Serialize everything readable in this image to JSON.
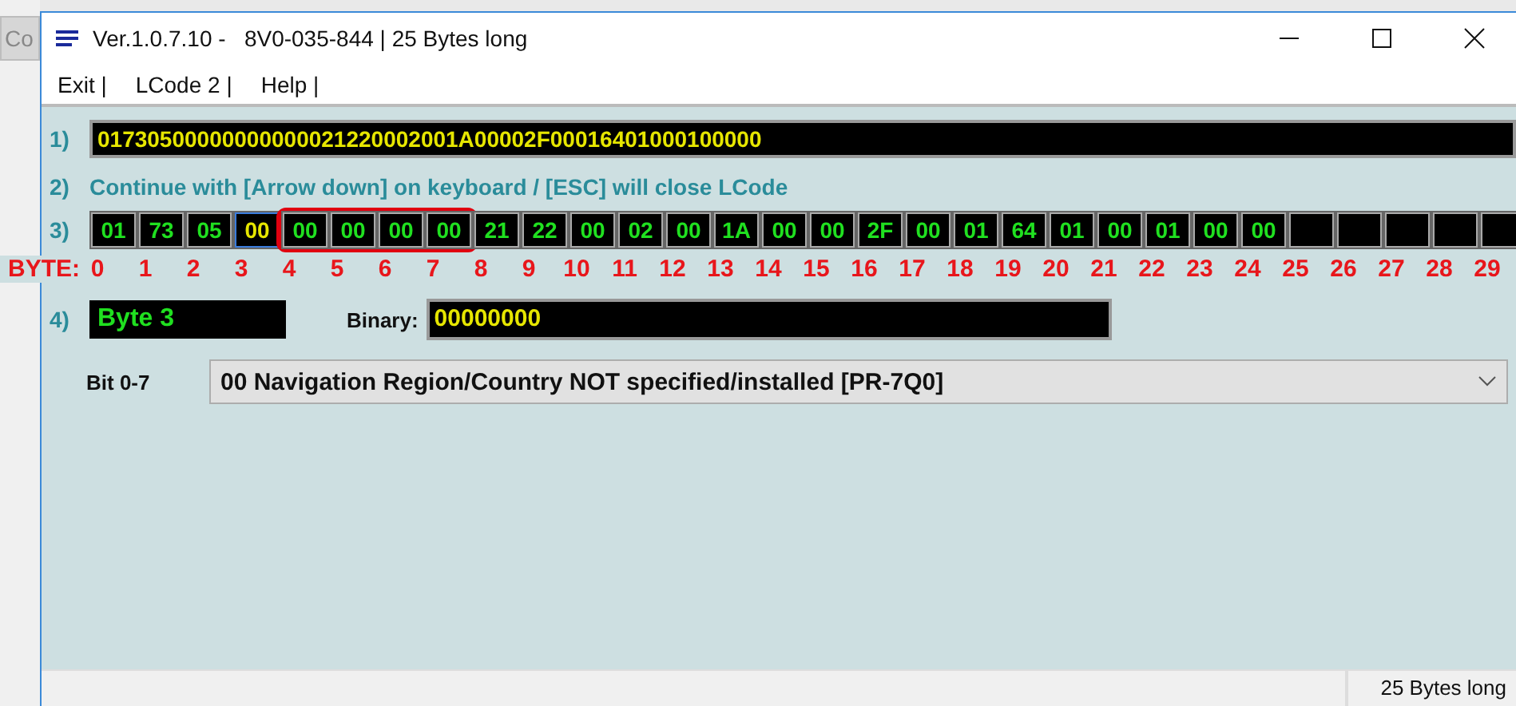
{
  "background_window": {
    "button_label": "Co"
  },
  "window": {
    "title": "Ver.1.0.7.10 -   8V0-035-844 | 25 Bytes long"
  },
  "menu": [
    "Exit |",
    "LCode 2 |",
    "Help |"
  ],
  "step1": {
    "label": "1)",
    "hex": "01730500000000000021220002001A00002F00016401000100000"
  },
  "step2": {
    "label": "2)",
    "text": "Continue with [Arrow down] on keyboard / [ESC] will close LCode"
  },
  "step3": {
    "label": "3)",
    "byte_caption": "BYTE:",
    "byte_groups": [
      {
        "highlighted": false,
        "bytes": [
          {
            "value": "01",
            "index": "0",
            "selected": false
          },
          {
            "value": "73",
            "index": "1",
            "selected": false
          },
          {
            "value": "05",
            "index": "2",
            "selected": false
          },
          {
            "value": "00",
            "index": "3",
            "selected": true
          }
        ]
      },
      {
        "highlighted": true,
        "bytes": [
          {
            "value": "00",
            "index": "4",
            "selected": false
          },
          {
            "value": "00",
            "index": "5",
            "selected": false
          },
          {
            "value": "00",
            "index": "6",
            "selected": false
          },
          {
            "value": "00",
            "index": "7",
            "selected": false
          }
        ]
      },
      {
        "highlighted": false,
        "bytes": [
          {
            "value": "21",
            "index": "8",
            "selected": false
          },
          {
            "value": "22",
            "index": "9",
            "selected": false
          },
          {
            "value": "00",
            "index": "10",
            "selected": false
          },
          {
            "value": "02",
            "index": "11",
            "selected": false
          },
          {
            "value": "00",
            "index": "12",
            "selected": false
          },
          {
            "value": "1A",
            "index": "13",
            "selected": false
          },
          {
            "value": "00",
            "index": "14",
            "selected": false
          },
          {
            "value": "00",
            "index": "15",
            "selected": false
          },
          {
            "value": "2F",
            "index": "16",
            "selected": false
          },
          {
            "value": "00",
            "index": "17",
            "selected": false
          },
          {
            "value": "01",
            "index": "18",
            "selected": false
          },
          {
            "value": "64",
            "index": "19",
            "selected": false
          },
          {
            "value": "01",
            "index": "20",
            "selected": false
          },
          {
            "value": "00",
            "index": "21",
            "selected": false
          },
          {
            "value": "01",
            "index": "22",
            "selected": false
          },
          {
            "value": "00",
            "index": "23",
            "selected": false
          },
          {
            "value": "00",
            "index": "24",
            "selected": false
          },
          {
            "index": "25",
            "selected": false
          },
          {
            "index": "26",
            "selected": false
          },
          {
            "index": "27",
            "selected": false
          },
          {
            "index": "28",
            "selected": false
          },
          {
            "index": "29",
            "selected": false
          }
        ]
      }
    ]
  },
  "step4": {
    "label": "4)",
    "byte_name": "Byte 3",
    "binary_label": "Binary:",
    "binary": "00000000",
    "bits_label": "Bit 0-7",
    "bits_value": "00 Navigation Region/Country NOT specified/installed [PR-7Q0]"
  },
  "status_bar": {
    "text": "25 Bytes long"
  }
}
